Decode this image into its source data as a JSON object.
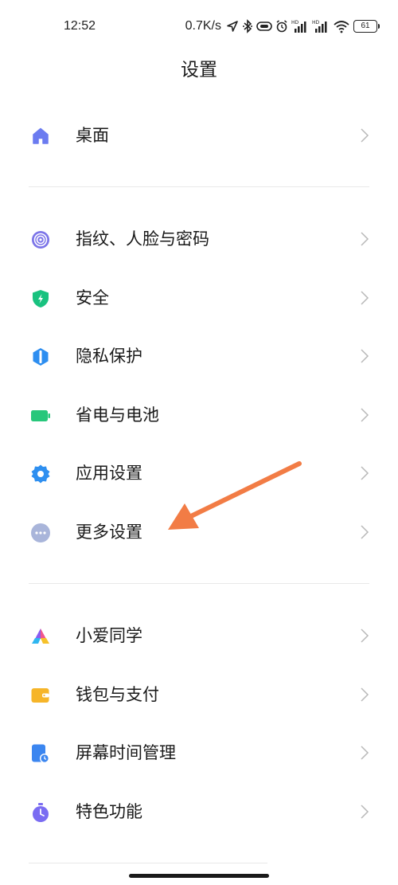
{
  "status_bar": {
    "time": "12:52",
    "speed": "0.7K/s",
    "battery": "61",
    "icons": [
      "location-icon",
      "bluetooth-icon",
      "hotspot-icon",
      "alarm-icon",
      "signal-hd-1-icon",
      "signal-hd-2-icon",
      "wifi-icon",
      "battery-icon"
    ]
  },
  "header": {
    "title": "设置"
  },
  "sections": [
    {
      "items": [
        {
          "label": "桌面",
          "icon": "home-icon",
          "color": "#6b7bf0"
        }
      ]
    },
    {
      "items": [
        {
          "label": "指纹、人脸与密码",
          "icon": "fingerprint-icon",
          "color": "#7b74e8"
        },
        {
          "label": "安全",
          "icon": "shield-icon",
          "color": "#19c27f"
        },
        {
          "label": "隐私保护",
          "icon": "privacy-icon",
          "color": "#2d8ef0"
        },
        {
          "label": "省电与电池",
          "icon": "battery-saver-icon",
          "color": "#27c77b"
        },
        {
          "label": "应用设置",
          "icon": "gear-icon",
          "color": "#2e8ff0"
        },
        {
          "label": "更多设置",
          "icon": "more-icon",
          "color": "#a9b5da"
        }
      ]
    },
    {
      "items": [
        {
          "label": "小爱同学",
          "icon": "xiaoai-icon",
          "color": "#f0568e"
        },
        {
          "label": "钱包与支付",
          "icon": "wallet-icon",
          "color": "#f6b529"
        },
        {
          "label": "屏幕时间管理",
          "icon": "screen-time-icon",
          "color": "#3b86f0"
        },
        {
          "label": "特色功能",
          "icon": "special-features-icon",
          "color": "#7a6cf2"
        }
      ]
    }
  ],
  "annotation": {
    "arrow_color": "#f27c45"
  }
}
